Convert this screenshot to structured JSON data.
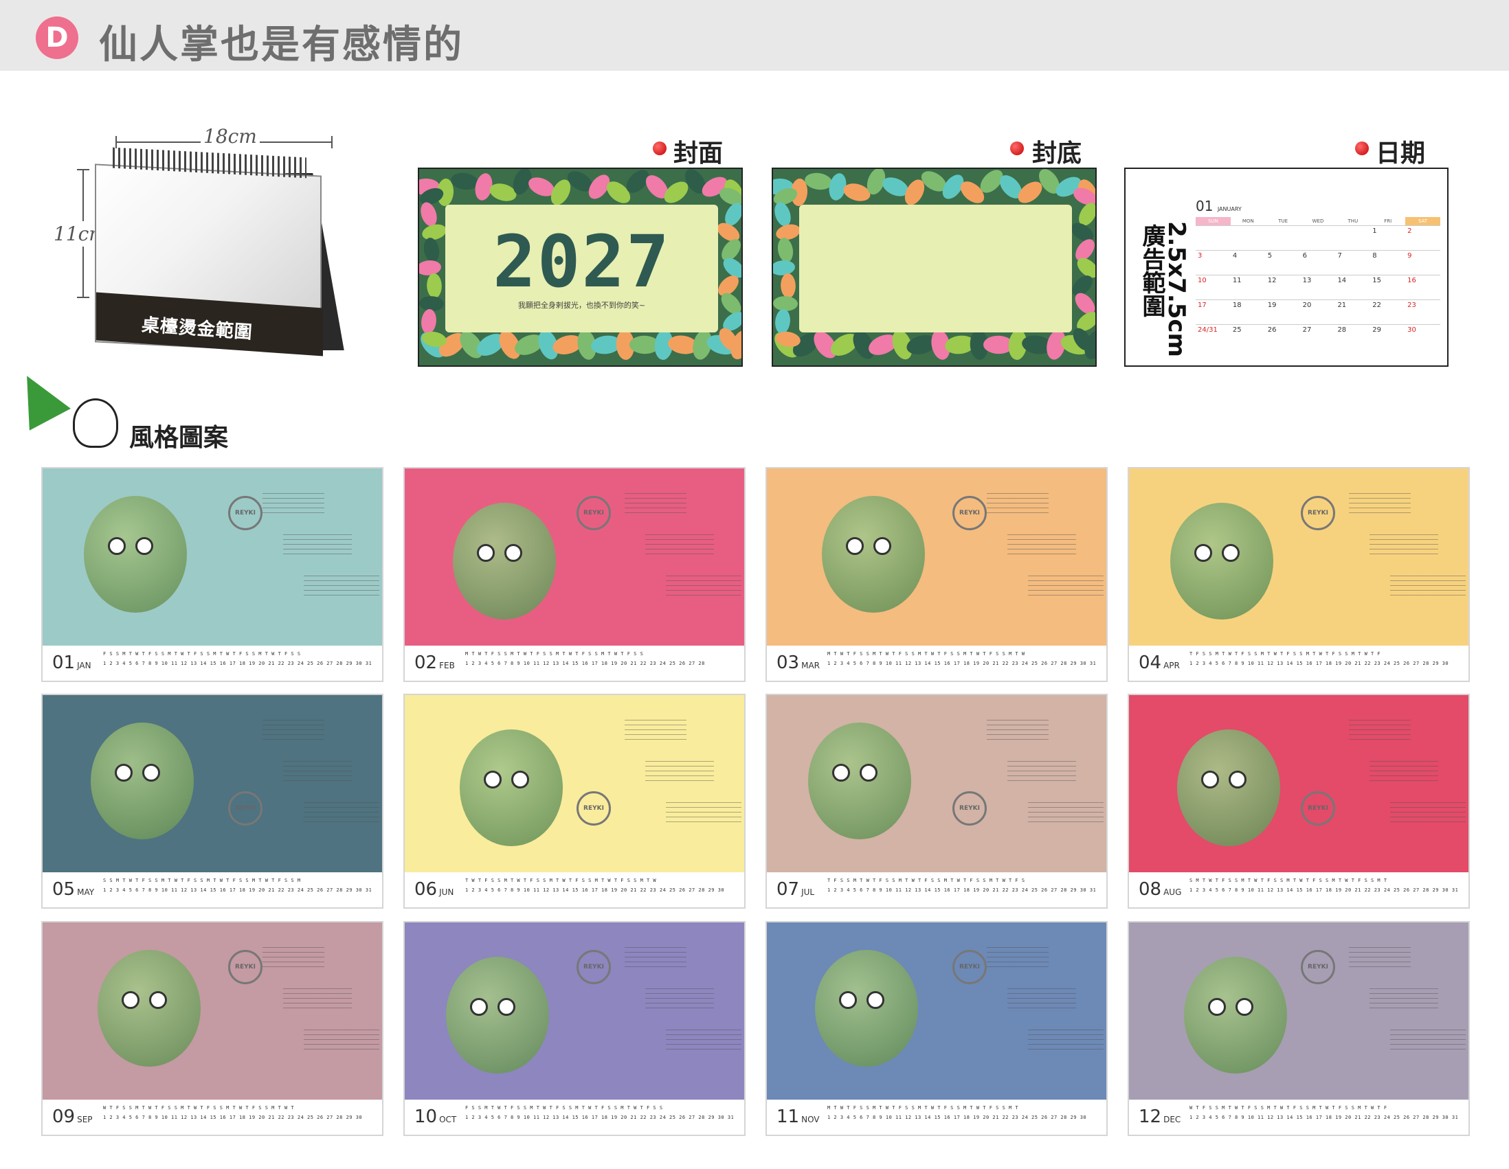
{
  "header": {
    "badge": "D",
    "title": "仙人掌也是有感情的"
  },
  "mockup": {
    "width_label": "18cm",
    "height_label": "11cm",
    "base_label": "桌檯燙金範圍"
  },
  "panels": {
    "front": {
      "label": "封面",
      "year": "2027",
      "note": "我願把全身剌拔光，也換不到你的笑~"
    },
    "back": {
      "label": "封底"
    },
    "date": {
      "label": "日期",
      "ad_line1": "2.5x7.5cm",
      "ad_line2": "廣告範圍",
      "month_num": "01",
      "month_name": "JANUARY",
      "weekdays": [
        "SUN",
        "MON",
        "TUE",
        "WED",
        "THU",
        "FRI",
        "SAT"
      ],
      "weeks": [
        [
          "",
          "",
          "",
          "",
          "",
          "1",
          "2"
        ],
        [
          "3",
          "4",
          "5",
          "6",
          "7",
          "8",
          "9"
        ],
        [
          "10",
          "11",
          "12",
          "13",
          "14",
          "15",
          "16"
        ],
        [
          "17",
          "18",
          "19",
          "20",
          "21",
          "22",
          "23"
        ],
        [
          "24|31",
          "25",
          "26",
          "27",
          "28",
          "29",
          "30"
        ]
      ]
    }
  },
  "style_section": {
    "label": "風格圖案"
  },
  "colors": {
    "badge": "#ef6f8e",
    "header_bg": "#e8e8e8",
    "year": "#2f5a52",
    "cover_bg": "#e7eeb2",
    "green_triangle": "#3a9a3a"
  },
  "months": [
    {
      "num": "01",
      "abbr": "JAN",
      "bg": "#9ccac7",
      "days1": "F S S M T W T F S S M T W T F S S M T W T F S S M T W T F S S",
      "days2": "1 2 3 4 5 6 7 8 9 10 11 12 13 14 15 16 17 18 19 20 21 22 23 24 25 26 27 28 29 30 31"
    },
    {
      "num": "02",
      "abbr": "FEB",
      "bg": "#e85e82",
      "days1": "M T W T F S S M T W T F S S M T W T F S S M T W T F S S",
      "days2": "1 2 3 4 5 6 7 8 9 10 11 12 13 14 15 16 17 18 19 20 21 22 23 24 25 26 27 28"
    },
    {
      "num": "03",
      "abbr": "MAR",
      "bg": "#f4bc7f",
      "days1": "M T W T F S S M T W T F S S M T W T F S S M T W T F S S M T W",
      "days2": "1 2 3 4 5 6 7 8 9 10 11 12 13 14 15 16 17 18 19 20 21 22 23 24 25 26 27 28 29 30 31"
    },
    {
      "num": "04",
      "abbr": "APR",
      "bg": "#f7d27e",
      "days1": "T F S S M T W T F S S M T W T F S S M T W T F S S M T W T F",
      "days2": "1 2 3 4 5 6 7 8 9 10 11 12 13 14 15 16 17 18 19 20 21 22 23 24 25 26 27 28 29 30"
    },
    {
      "num": "05",
      "abbr": "MAY",
      "bg": "#4f7380",
      "days1": "S S M T W T F S S M T W T F S S M T W T F S S M T W T F S S M",
      "days2": "1 2 3 4 5 6 7 8 9 10 11 12 13 14 15 16 17 18 19 20 21 22 23 24 25 26 27 28 29 30 31"
    },
    {
      "num": "06",
      "abbr": "JUN",
      "bg": "#f9ec9c",
      "days1": "T W T F S S M T W T F S S M T W T F S S M T W T F S S M T W",
      "days2": "1 2 3 4 5 6 7 8 9 10 11 12 13 14 15 16 17 18 19 20 21 22 23 24 25 26 27 28 29 30"
    },
    {
      "num": "07",
      "abbr": "JUL",
      "bg": "#d2b3a6",
      "days1": "T F S S M T W T F S S M T W T F S S M T W T F S S M T W T F S",
      "days2": "1 2 3 4 5 6 7 8 9 10 11 12 13 14 15 16 17 18 19 20 21 22 23 24 25 26 27 28 29 30 31"
    },
    {
      "num": "08",
      "abbr": "AUG",
      "bg": "#e34b69",
      "days1": "S M T W T F S S M T W T F S S M T W T F S S M T W T F S S M T",
      "days2": "1 2 3 4 5 6 7 8 9 10 11 12 13 14 15 16 17 18 19 20 21 22 23 24 25 26 27 28 29 30 31"
    },
    {
      "num": "09",
      "abbr": "SEP",
      "bg": "#c49aa3",
      "days1": "W T F S S M T W T F S S M T W T F S S M T W T F S S M T W T",
      "days2": "1 2 3 4 5 6 7 8 9 10 11 12 13 14 15 16 17 18 19 20 21 22 23 24 25 26 27 28 29 30"
    },
    {
      "num": "10",
      "abbr": "OCT",
      "bg": "#8d86bf",
      "days1": "F S S M T W T F S S M T W T F S S M T W T F S S M T W T F S S",
      "days2": "1 2 3 4 5 6 7 8 9 10 11 12 13 14 15 16 17 18 19 20 21 22 23 24 25 26 27 28 29 30 31"
    },
    {
      "num": "11",
      "abbr": "NOV",
      "bg": "#6d89b6",
      "days1": "M T W T F S S M T W T F S S M T W T F S S M T W T F S S M T",
      "days2": "1 2 3 4 5 6 7 8 9 10 11 12 13 14 15 16 17 18 19 20 21 22 23 24 25 26 27 28 29 30"
    },
    {
      "num": "12",
      "abbr": "DEC",
      "bg": "#a79eb3",
      "days1": "W T F S S M T W T F S S M T W T F S S M T W T F S S M T W T F",
      "days2": "1 2 3 4 5 6 7 8 9 10 11 12 13 14 15 16 17 18 19 20 21 22 23 24 25 26 27 28 29 30 31"
    }
  ],
  "stamp_text": "REYKI"
}
